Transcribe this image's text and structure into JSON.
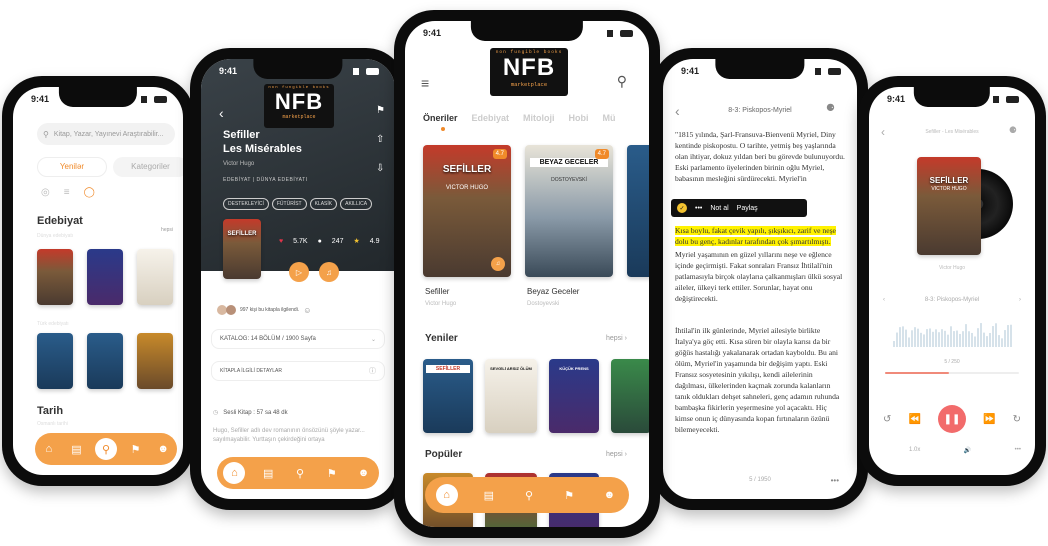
{
  "status_time": "9:41",
  "logo": {
    "top": "non fungible books",
    "main": "NFB",
    "bottom": "marketplace"
  },
  "search": {
    "placeholder": "Kitap, Yazar, Yayınevi Araştırabilir..."
  },
  "p1": {
    "tabs": [
      "Yenilər",
      "Kategoriler"
    ],
    "section1": "Edebiyat",
    "section1_sub": "Dünya edebiyatı",
    "section2_sub": "Türk edebiyatı",
    "section3": "Tarih",
    "section3_sub": "Osmanlı tarihi",
    "hepsi": "hepsi"
  },
  "p2": {
    "title1": "Sefiller",
    "title2": "Les Misérables",
    "author": "Victor Hugo",
    "category": "EDEBİYAT  |  DÜNYA EDEBİYATI",
    "tags": [
      "DESTEKLEYİCİ",
      "FÜTÜRİST",
      "KLASİK",
      "AKILLICA"
    ],
    "cover_title": "SEFİLLER",
    "likes": "5.7K",
    "comments": "247",
    "rating": "4.9",
    "readers": "997 kişi bu kitapla ilgilendi.",
    "catalog": "KATALOG: 14 BÖLÜM / 1900 Sayfa",
    "details": "KİTAPLA İLGİLİ DETAYLAR",
    "audio": "Sesli Kitap : 57 sa 48 dk",
    "desc": "Hugo, Sefiller adlı dev romanının önsözünü şöyle yazar... sayılmayabilir. Yurttaşın çekirdeğini ortaya"
  },
  "p3": {
    "tabs": [
      "Öneriler",
      "Edebiyat",
      "Mitoloji",
      "Hobi",
      "Mü"
    ],
    "books": [
      {
        "title": "Sefiller",
        "author": "Victor Hugo",
        "cover": "SEFİLLER",
        "cover_sub": "VICTOR HUGO",
        "rating": "4.7"
      },
      {
        "title": "Beyaz Geceler",
        "author": "Dostoyevski",
        "cover": "BEYAZ GECELER",
        "cover_sub": "DOSTOYEVSKİ",
        "rating": "4.7"
      }
    ],
    "section_new": "Yeniler",
    "section_popular": "Popüler",
    "hepsi": "hepsi",
    "new_books": [
      "SEFİLLER",
      "SEVGİLİ ARSIZ ÖLÜM",
      "KÜÇÜK PRENS",
      ""
    ]
  },
  "p4": {
    "chapter": "8-3: Piskopos-Myriel",
    "toolbar": {
      "note": "Not al",
      "share": "Paylaş"
    },
    "para1": "\"1815 yılında, Şarl-Fransuva-Bienvenü Myriel, Diny kentinde piskopostu. O tarihte, yetmiş beş yaşlarında olan ihtiyar, dokuz yıldan beri bu görevde bulunuyordu. Eski parlamento üyelerinden birinin oğlu Myriel, babasının mesleğini sürdürecekti. Myriel'in",
    "highlight": "Kısa boylu, fakat çevik yapılı, şıkşıkıcı, zarif ve neşe dolu bu genç, kadınlar tarafından çok şımartılmıştı.",
    "para2": "Myriel yaşamının en güzel yıllarını neşe ve eğlence içinde geçirmişti. Fakat sonraları Fransız İhtilali'nin patlamasıyla birçok olaylarıa çalkanmışları ülkü sosyal aileler, ülkeyi terk ettiler. Sorunlar, hayat onu değiştirecekti.",
    "para3": "İhtilal'in ilk günlerinde, Myriel ailesiyle birlikte İtalya'ya göç etti. Kısa süren bir olayla karısı da bir göğüs hastalığı yakalanarak ortadan kayboldu. Bu ani ölüm, Myriel'in yaşamında bir değişim yaptı. Eski Fransız sosyetesinin yıkılışı, kendi ailelerinin dağılması, ülkelerinden kaçmak zorunda kalanların tanık oldukları dehşet sahneleri, genç adamın ruhunda bambaşka fikirlerin yeşermesine yol açacaktı. Hiç kimse onun iç dünyasında kopan fırtınaların özünü bilemeyecekti.",
    "page": "5 / 1950"
  },
  "p5": {
    "header": "Sefiller - Les Misérables",
    "cover": "SEFİLLER",
    "cover_sub": "VICTOR HUGO",
    "author": "Victor Hugo",
    "chapter": "8-3: Piskopos-Myriel",
    "page": "5 / 250",
    "speed": "1.0x",
    "progress": 0.48
  }
}
